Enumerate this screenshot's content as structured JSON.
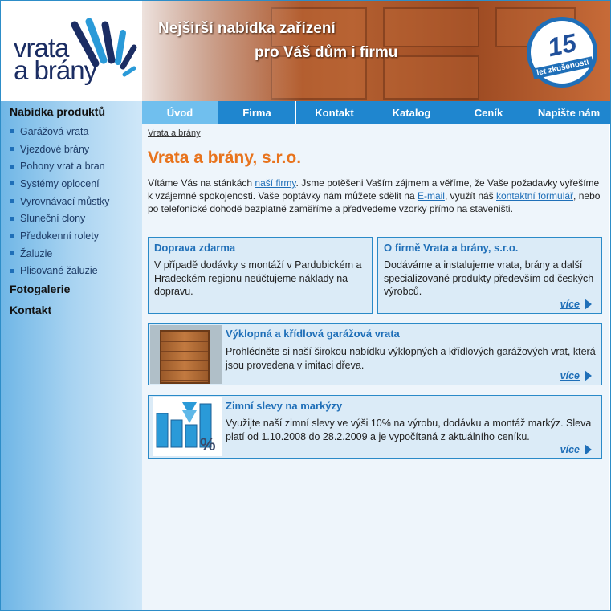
{
  "header": {
    "logo_line1": "vrata",
    "logo_line2": "a brány",
    "slogan_line1": "Nejširší nabídka zařízení",
    "slogan_line2": "pro Váš dům i firmu",
    "badge_number": "15",
    "badge_text": "let zkušeností"
  },
  "tabs": [
    {
      "label": "Úvod",
      "active": true
    },
    {
      "label": "Firma",
      "active": false
    },
    {
      "label": "Kontakt",
      "active": false
    },
    {
      "label": "Katalog",
      "active": false
    },
    {
      "label": "Ceník",
      "active": false
    },
    {
      "label": "Napište nám",
      "active": false
    }
  ],
  "sidebar": {
    "heading": "Nabídka produktů",
    "items": [
      "Garážová vrata",
      "Vjezdové brány",
      "Pohony vrat a bran",
      "Systémy oplocení",
      "Vyrovnávací můstky",
      "Sluneční clony",
      "Předokenní rolety",
      "Žaluzie",
      "Plisované žaluzie"
    ],
    "gallery": "Fotogalerie",
    "contact": "Kontakt"
  },
  "main": {
    "breadcrumb": "Vrata a brány",
    "title": "Vrata a brány, s.r.o.",
    "intro": {
      "p1": "Vítáme Vás na stánkách ",
      "link1": "naší firmy",
      "p2": ". Jsme potěšeni Vaším zájmem a věříme, že Vaše požadavky vyřešíme k vzájemné spokojenosti. Vaše poptávky nám můžete sdělit na ",
      "link2": "E-mail",
      "p3": ", využít náš ",
      "link3": "kontaktní formulář",
      "p4": ", nebo po telefonické dohodě bezplatně zaměříme a předvedeme vzorky přímo na staveništi."
    },
    "boxes": [
      {
        "title": "Doprava zdarma",
        "text": "V případě dodávky s montáží v Pardubickém a Hradeckém regionu neúčtujeme náklady na dopravu.",
        "more": ""
      },
      {
        "title": "O firmě Vrata a brány, s.r.o.",
        "text": "Dodáváme a instalujeme vrata, brány a další specializované produkty především od českých výrobců.",
        "more": "více"
      },
      {
        "title": "Výklopná a křídlová garážová vrata",
        "text": "Prohlédněte si naší širokou nabídku výklopných a křídlových garážových vrat, která jsou provedena v imitaci dřeva.",
        "more": "více"
      },
      {
        "title": "Zimní slevy na markýzy",
        "text": "Využijte naší zimní slevy ve výši 10% na výrobu, dodávku a montáž markýz. Sleva platí od 1.10.2008 do 28.2.2009 a je vypočítaná z aktuálního ceníku.",
        "more": "více"
      }
    ]
  },
  "colors": {
    "accent": "#1f86cf",
    "title": "#e8731c",
    "tab_active": "#70bfee"
  }
}
